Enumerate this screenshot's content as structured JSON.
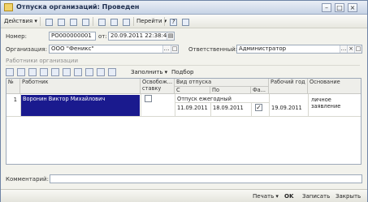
{
  "window": {
    "title": "Отпуска организаций: Проведен",
    "minimize_glyph": "–",
    "maximize_glyph": "□",
    "close_glyph": "×"
  },
  "toolbar": {
    "actions_label": "Действия ▾",
    "go_label": "Перейти ▾",
    "help_glyph": "?"
  },
  "form": {
    "number_label": "Номер:",
    "number_value": "РО000000001",
    "from_label": "от:",
    "date_value": "20.09.2011 22:38:40",
    "organization_label": "Организация:",
    "organization_value": "ООО \"Феникс\"",
    "responsible_label": "Ответственный:",
    "responsible_value": "Администратор",
    "comment_label": "Комментарий:"
  },
  "employees": {
    "section_title": "Работники организации",
    "fill_label": "Заполнить ▾",
    "select_label": "Подбор"
  },
  "table": {
    "headers": {
      "num": "№",
      "employee": "Работник",
      "release_1": "Освобож...",
      "release_2": "ставку",
      "vacation_type": "Вид отпуска",
      "from": "С",
      "to": "По",
      "actual": "Фа...",
      "work_year": "Рабочий год",
      "basis": "Основание"
    },
    "rows": [
      {
        "num": "1",
        "employee": "Воронин Виктор Михайлович",
        "vacation_type": "Отпуск ежегодный",
        "date_from": "11.09.2011",
        "date_to": "18.09.2011",
        "actual_checked": "✓",
        "work_year": "19.09.2011",
        "basis_1": "личное",
        "basis_2": "заявление"
      }
    ]
  },
  "footer": {
    "print_label": "Печать ▾",
    "ok_label": "OK",
    "save_label": "Записать",
    "close_label": "Закрыть"
  }
}
